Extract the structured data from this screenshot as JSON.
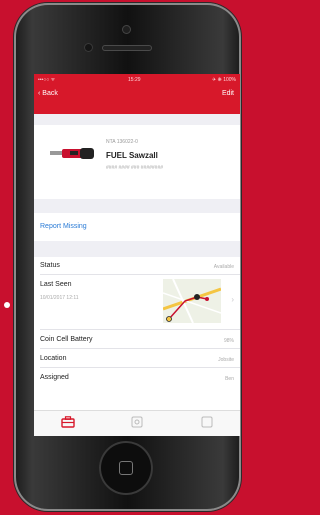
{
  "status_bar": {
    "carrier": "•••○○ ᯤ",
    "time": "15:29",
    "battery": "✈ ❋ 100%"
  },
  "nav": {
    "back_label": "‹ Back",
    "edit_label": "Edit"
  },
  "product": {
    "model": "NTA 136022-0",
    "name": "FUEL Sawzall",
    "serial": "#### #### ### ########"
  },
  "report_label": "Report Missing",
  "details": {
    "status_label": "Status",
    "status_value": "Available",
    "last_seen_label": "Last Seen",
    "last_seen_date": "10/01/2017 12:11",
    "battery_label": "Coin Cell Battery",
    "battery_value": "98%",
    "location_label": "Location",
    "location_value": "Jobsite",
    "assigned_label": "Assigned",
    "assigned_value": "Ben"
  },
  "colors": {
    "brand_red": "#d7182a",
    "link_blue": "#2a7bd6"
  },
  "tabs": [
    "toolbox-icon",
    "tracking-icon",
    "inventory-icon"
  ]
}
